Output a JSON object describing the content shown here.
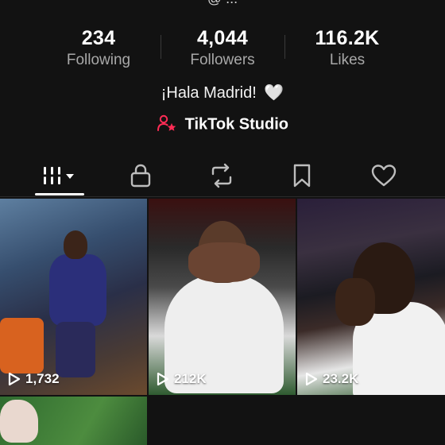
{
  "profile": {
    "username_partial": "@ ...",
    "bio": "¡Hala Madrid!",
    "bio_emoji": "🤍",
    "studio_label": "TikTok Studio"
  },
  "stats": [
    {
      "value": "234",
      "label": "Following"
    },
    {
      "value": "4,044",
      "label": "Followers"
    },
    {
      "value": "116.2K",
      "label": "Likes"
    }
  ],
  "tabs": [
    {
      "icon": "videos-grid-icon",
      "active": true
    },
    {
      "icon": "lock-icon",
      "active": false
    },
    {
      "icon": "repost-icon",
      "active": false
    },
    {
      "icon": "bookmark-icon",
      "active": false
    },
    {
      "icon": "heart-icon",
      "active": false
    }
  ],
  "videos": [
    {
      "views": "1,732"
    },
    {
      "views": "212K"
    },
    {
      "views": "23.2K"
    }
  ],
  "colors": {
    "background": "#121212",
    "secondary_text": "#a8a8a8",
    "accent_pink": "#fe2c55"
  }
}
